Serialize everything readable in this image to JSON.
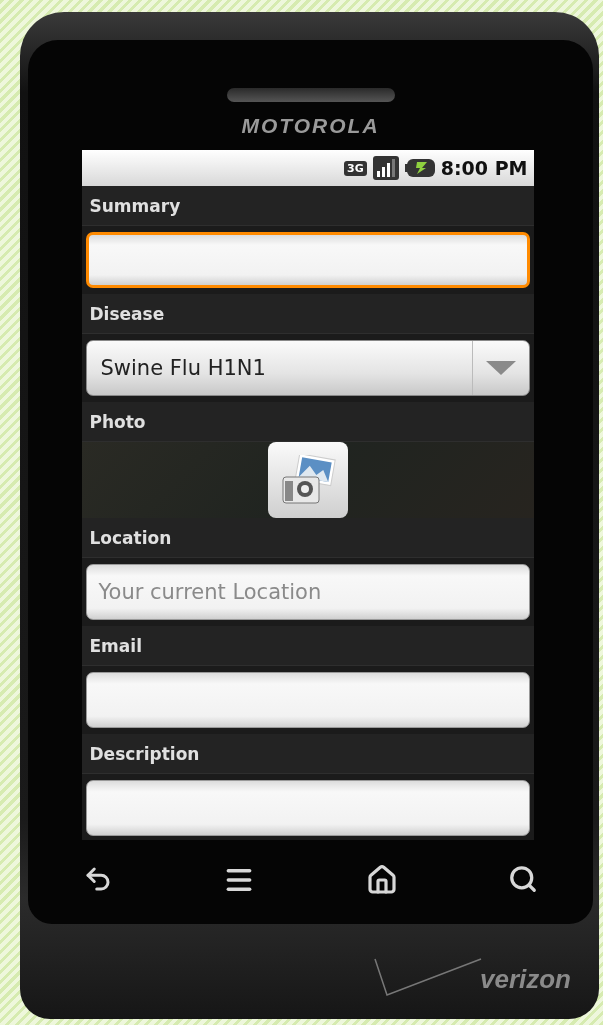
{
  "device": {
    "brand": "MOTOROLA",
    "carrier": "verizon"
  },
  "status_bar": {
    "network": "3G",
    "time": "8:00 PM"
  },
  "form": [
    {
      "kind": "text",
      "label": "Summary",
      "focused": true
    },
    {
      "kind": "select",
      "label": "Disease",
      "value": "Swine Flu H1N1",
      "focused": false
    },
    {
      "kind": "photo",
      "label": "Photo",
      "focused": false
    },
    {
      "kind": "text",
      "label": "Location",
      "placeholder": "Your current Location",
      "focused": false
    },
    {
      "kind": "text",
      "label": "Email",
      "focused": false
    },
    {
      "kind": "text",
      "label": "Description",
      "focused": false
    }
  ]
}
